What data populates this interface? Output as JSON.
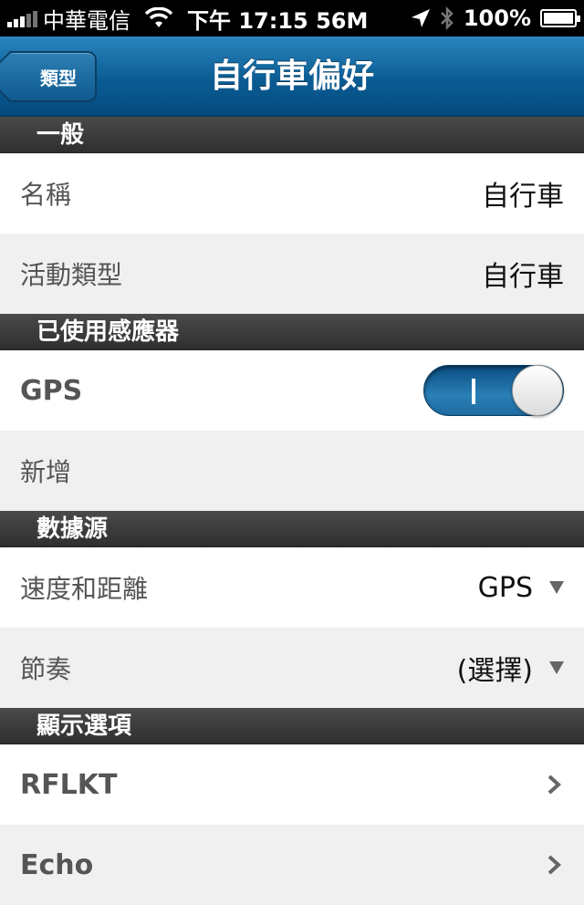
{
  "status_bar": {
    "carrier": "中華電信",
    "time": "下午 17:15 56M",
    "battery": "100%"
  },
  "nav": {
    "back_label": "類型",
    "title": "自行車偏好"
  },
  "sections": {
    "general": {
      "header": "一般",
      "name_label": "名稱",
      "name_value": "自行車",
      "activity_label": "活動類型",
      "activity_value": "自行車"
    },
    "sensors": {
      "header": "已使用感應器",
      "gps_label": "GPS",
      "gps_enabled": true,
      "add_label": "新增"
    },
    "data_source": {
      "header": "數據源",
      "speed_label": "速度和距離",
      "speed_value": "GPS",
      "cadence_label": "節奏",
      "cadence_value": "(選擇)"
    },
    "display": {
      "header": "顯示選項",
      "rflkt_label": "RFLKT",
      "echo_label": "Echo"
    }
  },
  "icons": [
    "wifi-icon",
    "location-arrow-icon",
    "bluetooth-icon",
    "battery-icon",
    "dropdown-arrow-icon",
    "chevron-right-icon"
  ]
}
